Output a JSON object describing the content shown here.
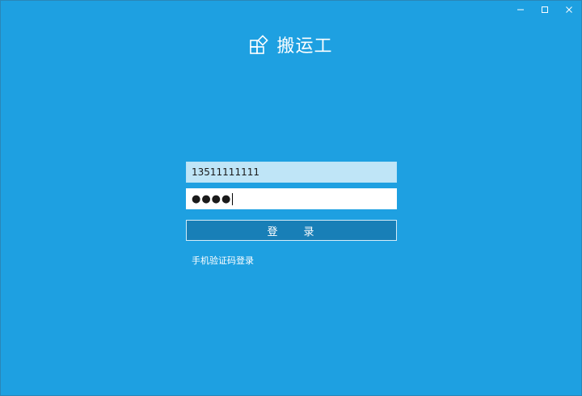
{
  "app": {
    "name": "搬运工"
  },
  "window": {
    "controls": {
      "minimize": "–",
      "maximize": "□",
      "close": "✕"
    }
  },
  "login": {
    "phone_value": "13511111111",
    "password_mask": "●●●●",
    "submit_label": "登　　录",
    "alt_login_link": "手机验证码登录"
  },
  "colors": {
    "background": "#1ea0e1",
    "button": "#187fb7",
    "input_bg": "#bfe5f7"
  },
  "icons": {
    "logo": "logo-icon",
    "minimize": "minimize-icon",
    "maximize": "maximize-icon",
    "close": "close-icon"
  }
}
